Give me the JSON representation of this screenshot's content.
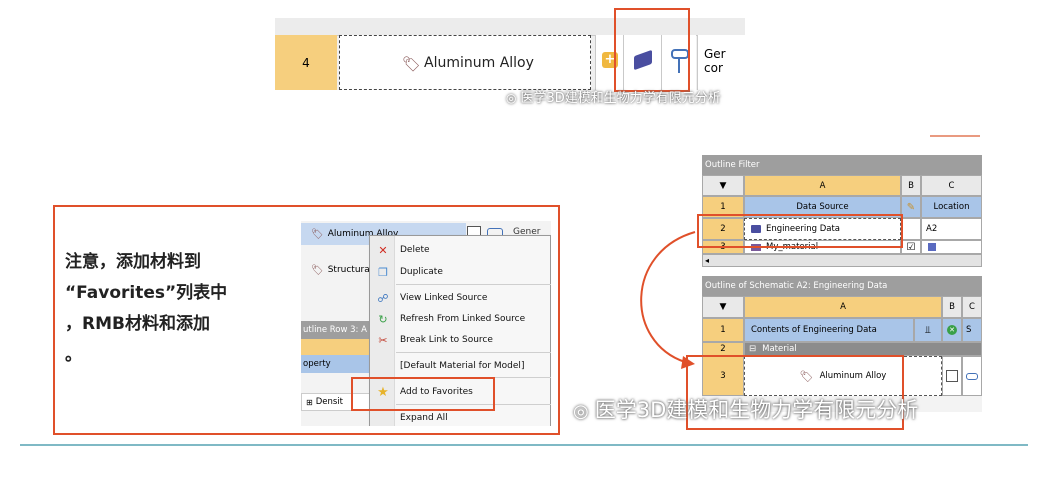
{
  "top_strip": {
    "row_number": "4",
    "material_name": "Aluminum Alloy",
    "gen_text_line1": "Ger",
    "gen_text_line2": "cor"
  },
  "watermark": {
    "small": "医学3D建模和生物力学有限元分析",
    "large": "医学3D建模和生物力学有限元分析"
  },
  "note": {
    "line1": "注意，添加材料到",
    "line2": "“Favorites”列表中",
    "line3": "，RMB材料和添加",
    "line4": "。"
  },
  "context_menu": {
    "header_item": "Aluminum Alloy",
    "header_gen": "Gener",
    "second_item": "Structural",
    "outline_row": "utline Row 3: A",
    "property_header": "operty",
    "density": "Densit",
    "items": {
      "delete": "Delete",
      "duplicate": "Duplicate",
      "view_linked": "View Linked Source",
      "refresh_linked": "Refresh From Linked Source",
      "break_link": "Break Link to Source",
      "default_material": "[Default Material for Model]",
      "add_favorites": "Add to Favorites",
      "expand_all": "Expand All"
    }
  },
  "outline_filter": {
    "title": "Outline Filter",
    "col_a": "A",
    "col_b": "B",
    "col_c": "C",
    "row1_num": "1",
    "row1_a": "Data Source",
    "row1_c": "Location",
    "row2_num": "2",
    "row2_a": "Engineering Data",
    "row2_c": "A2",
    "row3_num": "3",
    "row3_a": "My_material"
  },
  "schematic_outline": {
    "title": "Outline of Schematic A2: Engineering Data",
    "col_a": "A",
    "col_b": "B",
    "col_c": "C",
    "row1_num": "1",
    "row1_a": "Contents of Engineering Data",
    "row1_c": "S",
    "row2_num": "2",
    "row2_a": "Material",
    "row3_num": "3",
    "row3_a": "Aluminum Alloy"
  },
  "colors": {
    "highlight_red": "#e0502a",
    "row_header_yellow": "#f6cf7e",
    "header_blue": "#a9c5e8",
    "title_gray": "#9e9e9e",
    "teal_line": "#7fb9c5"
  }
}
